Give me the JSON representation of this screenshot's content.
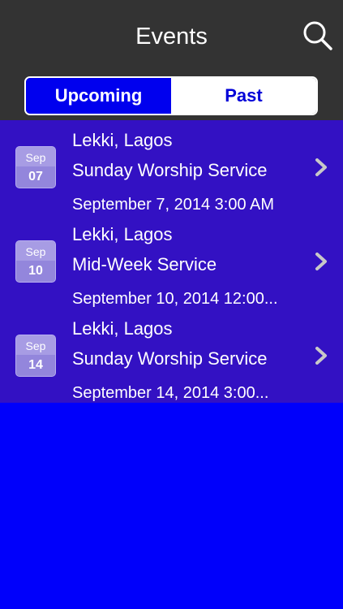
{
  "header": {
    "title": "Events",
    "search_icon": "search-icon"
  },
  "tabs": [
    {
      "label": "Upcoming",
      "active": true
    },
    {
      "label": "Past",
      "active": false
    }
  ],
  "events": [
    {
      "month": "Sep",
      "day": "07",
      "location": "Lekki, Lagos",
      "name": "Sunday Worship Service",
      "datetime": "September 7, 2014 3:00 AM"
    },
    {
      "month": "Sep",
      "day": "10",
      "location": "Lekki, Lagos",
      "name": "Mid-Week Service",
      "datetime": "September 10, 2014 12:00..."
    },
    {
      "month": "Sep",
      "day": "14",
      "location": "Lekki, Lagos",
      "name": "Sunday Worship Service",
      "datetime": "September 14, 2014 3:00..."
    }
  ],
  "colors": {
    "header_bg": "#333333",
    "list_bg": "#3311c3",
    "page_bg": "#0000fb",
    "tab_active": "#0000ee",
    "tab_inactive_text": "#0000d8"
  }
}
